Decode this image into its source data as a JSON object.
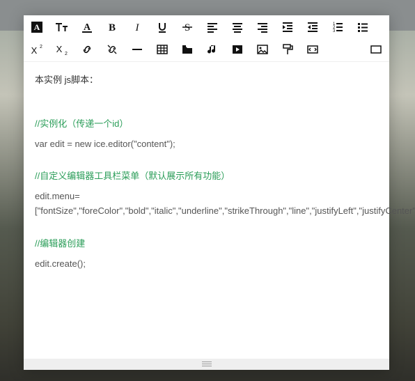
{
  "toolbar": {
    "row1": [
      {
        "name": "backcolor-icon"
      },
      {
        "name": "fontsize-icon"
      },
      {
        "name": "forecolor-icon"
      },
      {
        "name": "bold-icon"
      },
      {
        "name": "italic-icon"
      },
      {
        "name": "underline-icon"
      },
      {
        "name": "strikethrough-icon"
      },
      {
        "name": "justify-left-icon"
      },
      {
        "name": "justify-center-icon"
      },
      {
        "name": "justify-right-icon"
      },
      {
        "name": "indent-icon"
      },
      {
        "name": "outdent-icon"
      },
      {
        "name": "ordered-list-icon"
      },
      {
        "name": "unordered-list-icon"
      }
    ],
    "row2": [
      {
        "name": "superscript-icon"
      },
      {
        "name": "subscript-icon"
      },
      {
        "name": "link-icon"
      },
      {
        "name": "unlink-icon"
      },
      {
        "name": "hr-icon"
      },
      {
        "name": "table-icon"
      },
      {
        "name": "files-icon"
      },
      {
        "name": "music-icon"
      },
      {
        "name": "video-icon"
      },
      {
        "name": "image-icon"
      },
      {
        "name": "paint-format-icon"
      },
      {
        "name": "code-icon"
      }
    ],
    "row2_right": [
      {
        "name": "fullscreen-icon"
      }
    ]
  },
  "content": {
    "intro": "本实例 js脚本：",
    "c1": "//实例化（传递一个id）",
    "l1": "var edit = new ice.editor(\"content\");",
    "c2": "//自定义编辑器工具栏菜单（默认展示所有功能）",
    "l2": "edit.menu=[\"fontSize\",\"foreColor\",\"bold\",\"italic\",\"underline\",\"strikeThrough\",\"line\",\"justifyLeft\",\"justifyCenter\",\"justifyRight\",\"line\",\"table\",\"insertImage\"];",
    "c3": "//编辑器创建",
    "l3": "edit.create();"
  }
}
